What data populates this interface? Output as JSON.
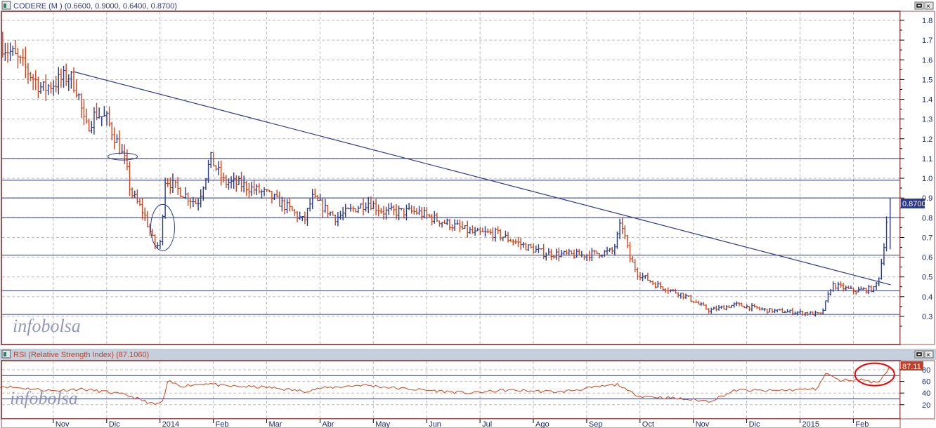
{
  "main_panel": {
    "title": "CODERE (M ) (0.6600, 0.9000, 0.6400, 0.8700)",
    "last_value_label": "0.8700",
    "watermark": "infobolsa"
  },
  "rsi_panel": {
    "title": "RSI (Relative Strength Index) (87.1060)",
    "last_value_label": "87.11",
    "watermark": "infobolsa"
  },
  "colors": {
    "up": "#2b3a8a",
    "down": "#d4421a",
    "rsi_line": "#d4421a",
    "level_line": "#2b3a8a",
    "frame": "#a05050"
  },
  "chart_data": [
    {
      "type": "ohlc",
      "title": "CODERE (M )",
      "ohlc_last": {
        "open": 0.66,
        "high": 0.9,
        "low": 0.64,
        "close": 0.87
      },
      "ylim": [
        0.2,
        1.85
      ],
      "yticks": [
        "1.8",
        "1.7",
        "1.6",
        "1.5",
        "1.4",
        "1.3",
        "1.2",
        "1.1",
        "1.0",
        "0.9",
        "0.8",
        "0.7",
        "0.6",
        "0.5",
        "0.4",
        "0.3"
      ],
      "x_unit": "months since Oct 2013",
      "xticks": [
        {
          "t": 1,
          "label": "Nov"
        },
        {
          "t": 2,
          "label": "Dic"
        },
        {
          "t": 3,
          "label": "2014"
        },
        {
          "t": 4,
          "label": "Feb"
        },
        {
          "t": 5,
          "label": "Mar"
        },
        {
          "t": 6,
          "label": "Abr"
        },
        {
          "t": 7,
          "label": "May"
        },
        {
          "t": 8,
          "label": "Jun"
        },
        {
          "t": 9,
          "label": "Jul"
        },
        {
          "t": 10,
          "label": "Ago"
        },
        {
          "t": 11,
          "label": "Sep"
        },
        {
          "t": 12,
          "label": "Oct"
        },
        {
          "t": 13,
          "label": "Nov"
        },
        {
          "t": 14,
          "label": "Dic"
        },
        {
          "t": 15,
          "label": "2015"
        },
        {
          "t": 16,
          "label": "Feb"
        }
      ],
      "close_path": [
        [
          0.05,
          1.68
        ],
        [
          0.5,
          1.55
        ],
        [
          0.8,
          1.45
        ],
        [
          1.0,
          1.48
        ],
        [
          1.3,
          1.52
        ],
        [
          1.45,
          1.45
        ],
        [
          1.6,
          1.25
        ],
        [
          1.8,
          1.33
        ],
        [
          2.0,
          1.3
        ],
        [
          2.2,
          1.18
        ],
        [
          2.35,
          1.08
        ],
        [
          2.45,
          0.93
        ],
        [
          2.7,
          0.82
        ],
        [
          2.9,
          0.66
        ],
        [
          3.0,
          0.66
        ],
        [
          3.1,
          1.0
        ],
        [
          3.3,
          0.95
        ],
        [
          3.7,
          0.87
        ],
        [
          3.95,
          1.1
        ],
        [
          4.2,
          0.98
        ],
        [
          4.5,
          0.97
        ],
        [
          5.0,
          0.92
        ],
        [
          5.4,
          0.85
        ],
        [
          5.7,
          0.78
        ],
        [
          5.85,
          0.9
        ],
        [
          6.3,
          0.8
        ],
        [
          6.9,
          0.88
        ],
        [
          7.2,
          0.83
        ],
        [
          7.8,
          0.83
        ],
        [
          8.3,
          0.78
        ],
        [
          8.9,
          0.72
        ],
        [
          9.3,
          0.72
        ],
        [
          9.9,
          0.65
        ],
        [
          10.2,
          0.62
        ],
        [
          10.9,
          0.61
        ],
        [
          11.5,
          0.63
        ],
        [
          11.65,
          0.78
        ],
        [
          11.8,
          0.6
        ],
        [
          11.95,
          0.52
        ],
        [
          12.3,
          0.46
        ],
        [
          12.8,
          0.41
        ],
        [
          13.3,
          0.33
        ],
        [
          13.8,
          0.36
        ],
        [
          14.4,
          0.33
        ],
        [
          15.0,
          0.32
        ],
        [
          15.4,
          0.31
        ],
        [
          15.6,
          0.46
        ],
        [
          16.0,
          0.43
        ],
        [
          16.4,
          0.44
        ],
        [
          16.5,
          0.52
        ],
        [
          16.6,
          0.72
        ],
        [
          16.65,
          0.87
        ]
      ],
      "horizontal_levels": [
        1.1,
        0.99,
        0.9,
        0.8,
        0.61,
        0.43,
        0.31
      ],
      "trendline": [
        [
          1.38,
          1.54
        ],
        [
          16.7,
          0.46
        ]
      ],
      "annotations": [
        {
          "type": "ellipse",
          "t": 2.3,
          "y": 1.11
        },
        {
          "type": "ellipse",
          "t": 3.05,
          "y": 0.75
        }
      ]
    },
    {
      "type": "line",
      "title": "RSI (Relative Strength Index)",
      "last": 87.106,
      "ylim": [
        0,
        100
      ],
      "yticks": [
        "80",
        "60",
        "40",
        "20"
      ],
      "levels": [
        70,
        30
      ],
      "series": [
        {
          "name": "RSI",
          "points": [
            [
              0,
              52
            ],
            [
              1,
              44
            ],
            [
              1.5,
              47
            ],
            [
              2,
              42
            ],
            [
              2.4,
              36
            ],
            [
              2.9,
              20
            ],
            [
              3.05,
              25
            ],
            [
              3.15,
              60
            ],
            [
              3.4,
              52
            ],
            [
              3.9,
              57
            ],
            [
              4.2,
              52
            ],
            [
              5,
              50
            ],
            [
              5.7,
              43
            ],
            [
              6,
              48
            ],
            [
              6.8,
              54
            ],
            [
              7.5,
              48
            ],
            [
              8.8,
              40
            ],
            [
              9.5,
              45
            ],
            [
              10.5,
              42
            ],
            [
              11.6,
              55
            ],
            [
              11.75,
              44
            ],
            [
              12.0,
              35
            ],
            [
              12.5,
              32
            ],
            [
              13.3,
              26
            ],
            [
              13.8,
              45
            ],
            [
              14.4,
              44
            ],
            [
              15.3,
              47
            ],
            [
              15.5,
              75
            ],
            [
              15.7,
              62
            ],
            [
              16.2,
              63
            ],
            [
              16.4,
              58
            ],
            [
              16.5,
              62
            ],
            [
              16.7,
              87
            ]
          ]
        }
      ],
      "annotations": [
        {
          "type": "ellipse",
          "t": 16.4,
          "y": 72
        }
      ]
    }
  ]
}
